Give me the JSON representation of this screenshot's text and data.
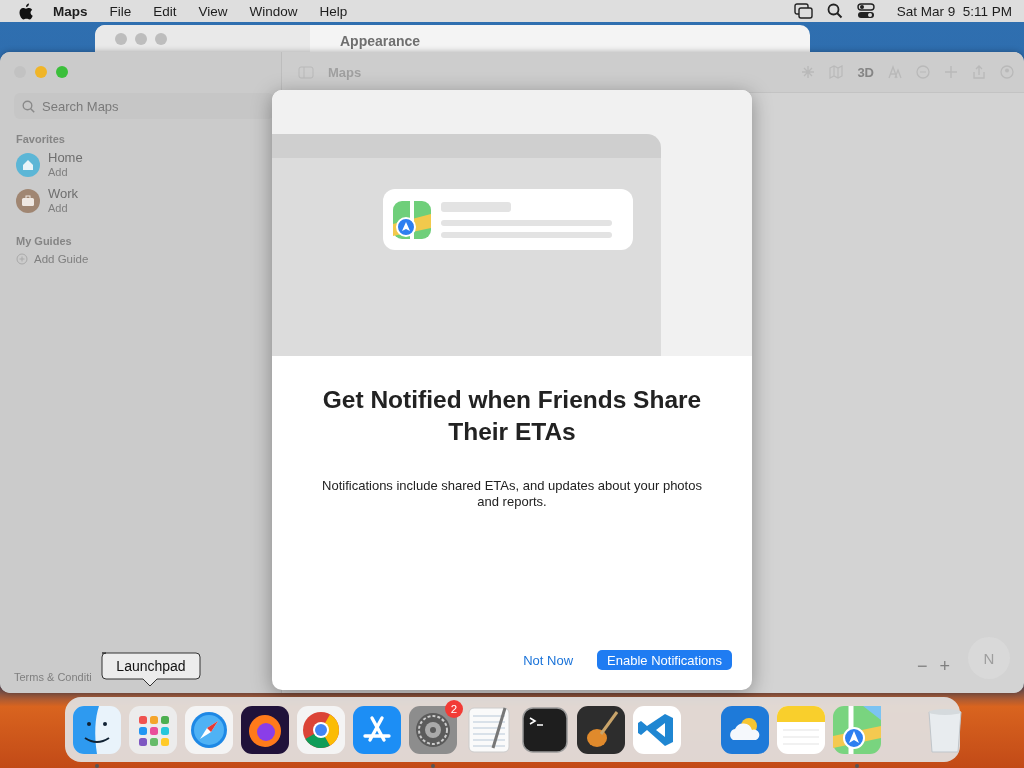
{
  "menubar": {
    "app": "Maps",
    "menus": [
      "File",
      "Edit",
      "View",
      "Window",
      "Help"
    ],
    "clock": "Sat Mar 9  5:11 PM"
  },
  "back_window": {
    "title": "Appearance"
  },
  "maps_window": {
    "title": "Maps",
    "toolbar_label": "3D",
    "search": {
      "placeholder": "Search Maps"
    },
    "sections": [
      {
        "title": "Favorites",
        "items": [
          {
            "kind": "place",
            "label": "Home",
            "detail": "Add",
            "color": "#5cb6d6"
          },
          {
            "kind": "place",
            "label": "Work",
            "detail": "Add",
            "color": "#a08672"
          }
        ]
      },
      {
        "title": "My Guides",
        "items": [
          {
            "kind": "add",
            "label": "Add Guide"
          }
        ]
      }
    ],
    "footer": "Terms & Conditi",
    "zoom_out": "−",
    "zoom_in": "+",
    "compass": "N"
  },
  "sheet": {
    "title": "Get Notified when Friends Share Their ETAs",
    "body": "Notifications include shared ETAs, and updates about your photos and reports.",
    "buttons": [
      {
        "kind": "link",
        "label": "Not Now"
      },
      {
        "kind": "primary",
        "label": "Enable Notifications"
      }
    ]
  },
  "dock": {
    "tooltip": "Launchpad",
    "groups": [
      [
        {
          "running": true
        },
        {
          "running": false
        },
        {
          "running": false
        },
        {
          "running": false
        },
        {
          "running": false
        },
        {
          "running": false
        },
        {
          "running": true,
          "badge": "2"
        },
        {
          "running": false
        },
        {
          "running": false
        },
        {
          "running": false
        },
        {
          "running": false
        }
      ],
      [
        {
          "running": false
        },
        {
          "running": false
        },
        {
          "running": true
        }
      ],
      [
        {
          "running": false
        }
      ]
    ]
  }
}
